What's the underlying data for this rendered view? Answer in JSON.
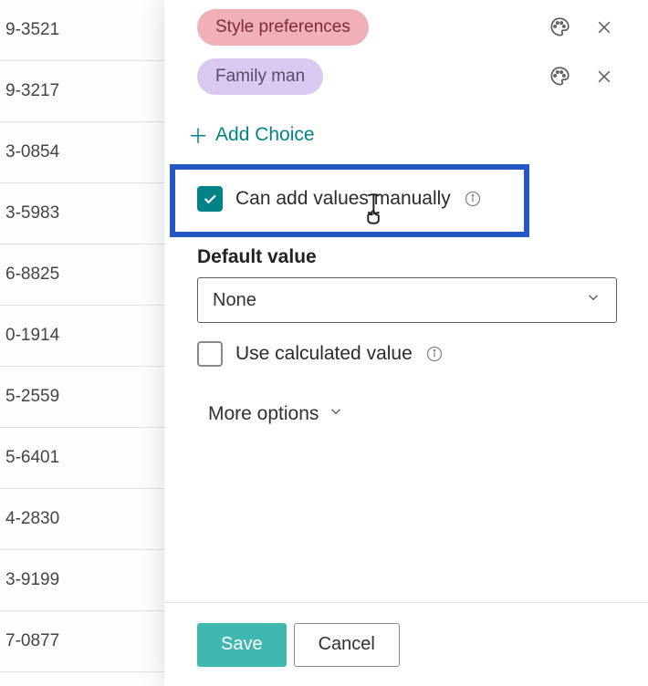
{
  "bg_list": {
    "rows": [
      {
        "value": "9-3521"
      },
      {
        "value": "9-3217"
      },
      {
        "value": "3-0854"
      },
      {
        "value": "3-5983"
      },
      {
        "value": "6-8825"
      },
      {
        "value": "0-1914"
      },
      {
        "value": "5-2559"
      },
      {
        "value": "5-6401"
      },
      {
        "value": "4-2830"
      },
      {
        "value": "3-9199"
      },
      {
        "value": "7-0877"
      }
    ]
  },
  "panel": {
    "choices": [
      {
        "label": "Style preferences",
        "color": "pink"
      },
      {
        "label": "Family man",
        "color": "purple"
      }
    ],
    "add_choice_label": "Add Choice",
    "can_add_values": {
      "checked": true,
      "label": "Can add values manually"
    },
    "default_value": {
      "heading": "Default value",
      "selected": "None"
    },
    "use_calculated": {
      "checked": false,
      "label": "Use calculated value"
    },
    "more_options_label": "More options",
    "footer": {
      "save_label": "Save",
      "cancel_label": "Cancel"
    }
  }
}
